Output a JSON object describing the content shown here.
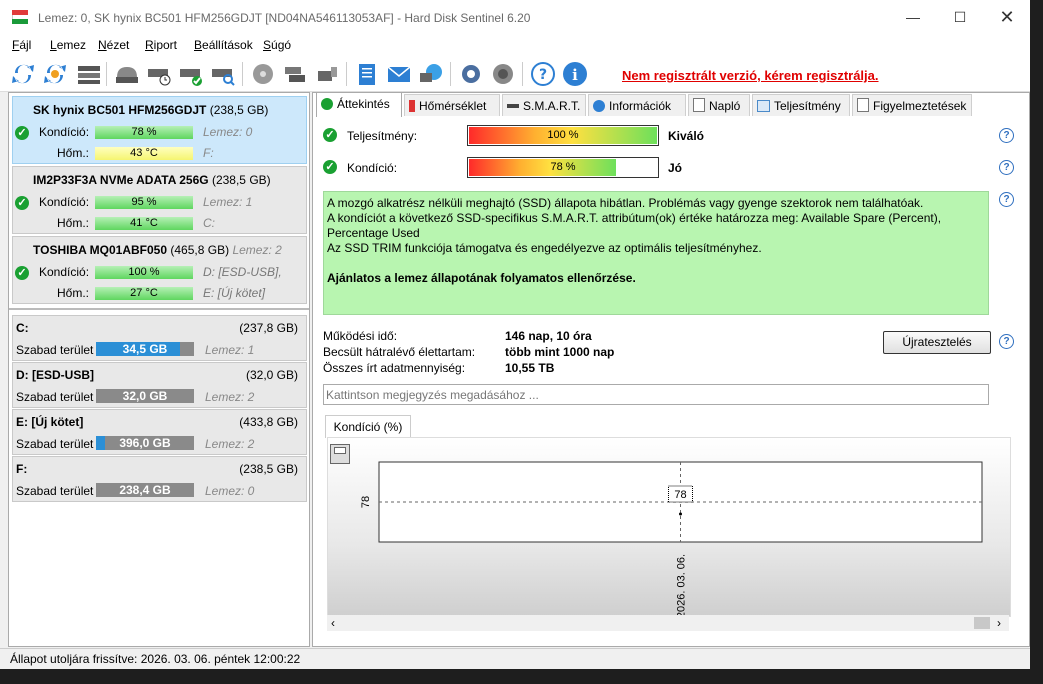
{
  "window": {
    "title": "Lemez: 0, SK hynix BC501 HFM256GDJT [ND04NA546113053AF]  -  Hard Disk Sentinel 6.20"
  },
  "menu": [
    {
      "label": "Fájl",
      "u": "F",
      "rest": "ájl"
    },
    {
      "label": "Lemez",
      "u": "L",
      "rest": "emez"
    },
    {
      "label": "Nézet",
      "u": "N",
      "rest": "ézet"
    },
    {
      "label": "Riport",
      "u": "R",
      "rest": "iport"
    },
    {
      "label": "Beállítások",
      "u": "B",
      "rest": "eállítások"
    },
    {
      "label": "Súgó",
      "u": "S",
      "rest": "úgó"
    }
  ],
  "toolbar": {
    "unregistered": "Nem regisztrált verzió, kérem regisztrálja."
  },
  "disks": [
    {
      "name": "SK hynix BC501 HFM256GDJT",
      "capacity": "(238,5 GB)",
      "lemez": "",
      "condition_label": "Kondíció:",
      "condition": "78 %",
      "condition_side": "Lemez: 0",
      "temp_label": "Hőm.:",
      "temp": "43 °C",
      "temp_side": "F:"
    },
    {
      "name": "IM2P33F3A NVMe ADATA 256G",
      "capacity": "(238,5 GB)",
      "lemez": "",
      "condition_label": "Kondíció:",
      "condition": "95 %",
      "condition_side": "Lemez: 1",
      "temp_label": "Hőm.:",
      "temp": "41 °C",
      "temp_side": "C:"
    },
    {
      "name": "TOSHIBA MQ01ABF050",
      "capacity": "(465,8 GB)",
      "lemez": "Lemez: 2",
      "condition_label": "Kondíció:",
      "condition": "100 %",
      "condition_side": "D: [ESD-USB],",
      "temp_label": "Hőm.:",
      "temp": "27 °C",
      "temp_side": "E: [Új kötet]"
    }
  ],
  "volumes": [
    {
      "name": "C:",
      "size": "(237,8 GB)",
      "free_label": "Szabad terület",
      "free": "34,5 GB",
      "used_fraction": 0.855,
      "disk": "Lemez: 1"
    },
    {
      "name": "D: [ESD-USB]",
      "size": "(32,0 GB)",
      "free_label": "Szabad terület",
      "free": "32,0 GB",
      "used_fraction": 0.0,
      "disk": "Lemez: 2"
    },
    {
      "name": "E: [Új kötet]",
      "size": "(433,8 GB)",
      "free_label": "Szabad terület",
      "free": "396,0 GB",
      "used_fraction": 0.087,
      "disk": "Lemez: 2"
    },
    {
      "name": "F:",
      "size": "(238,5 GB)",
      "free_label": "Szabad terület",
      "free": "238,4 GB",
      "used_fraction": 0.0,
      "disk": "Lemez: 0"
    }
  ],
  "tabs": [
    "Áttekintés",
    "Hőmérséklet",
    "S.M.A.R.T.",
    "Információk",
    "Napló",
    "Teljesítmény",
    "Figyelmeztetések"
  ],
  "overview": {
    "performance_label": "Teljesítmény:",
    "performance_value": "100 %",
    "performance_fraction": 1.0,
    "performance_rating": "Kiváló",
    "condition_label": "Kondíció:",
    "condition_value": "78 %",
    "condition_fraction": 0.78,
    "condition_rating": "Jó",
    "description": [
      "A mozgó alkatrész nélküli meghajtó (SSD) állapota hibátlan. Problémás vagy gyenge szektorok nem találhatóak.",
      "A kondíciót a következő SSD-specifikus S.M.A.R.T. attribútum(ok) értéke határozza meg:  Available Spare (Percent),",
      "Percentage Used",
      "Az SSD TRIM funkciója támogatva és engedélyezve az optimális teljesítményhez.",
      "",
      "Ajánlatos a lemez állapotának folyamatos ellenőrzése."
    ],
    "uptime_label": "Működési idő:",
    "uptime": "146 nap, 10 óra",
    "remaining_label": "Becsült hátralévő élettartam:",
    "remaining": "több mint 1000 nap",
    "written_label": "Összes írt adatmennyiség:",
    "written": "10,55 TB",
    "retest_button": "Újratesztelés",
    "note_placeholder": "Kattintson megjegyzés megadásához ..."
  },
  "chart_tab": "Kondíció  (%)",
  "chart_data": {
    "type": "line",
    "title": "",
    "xlabel": "",
    "ylabel": "",
    "x": [
      "2026. 03. 06."
    ],
    "series": [
      {
        "values": [
          78
        ]
      }
    ],
    "y_tick_labels": [
      "78"
    ],
    "data_labels": [
      "78"
    ],
    "ylim": [
      78,
      78
    ]
  },
  "status": {
    "text": "Állapot utoljára frissítve: 2026. 03. 06. péntek 12:00:22"
  },
  "colors": {
    "unregistered": "#e00000",
    "good": "#1aa032",
    "volume_fill": "#2b8fd6",
    "description_bg": "#b8f5b0"
  }
}
